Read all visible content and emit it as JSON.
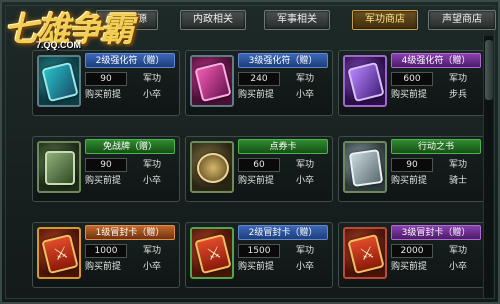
{
  "logo": {
    "title": "七雄争霸",
    "subtitle": "7.QQ.COM"
  },
  "tabs": [
    {
      "label": "购买资源"
    },
    {
      "label": "内政相关"
    },
    {
      "label": "军事相关"
    },
    {
      "label": "军功商店"
    },
    {
      "label": "声望商店"
    }
  ],
  "items": [
    {
      "name": "2级强化符（赠）",
      "price": "90",
      "currency": "军功",
      "requirement": "购买前提",
      "rank": "小卒"
    },
    {
      "name": "3级强化符（赠）",
      "price": "240",
      "currency": "军功",
      "requirement": "购买前提",
      "rank": "小卒"
    },
    {
      "name": "4级强化符（赠）",
      "price": "600",
      "currency": "军功",
      "requirement": "购买前提",
      "rank": "步兵"
    },
    {
      "name": "免战牌（赠）",
      "price": "90",
      "currency": "军功",
      "requirement": "购买前提",
      "rank": "小卒"
    },
    {
      "name": "点券卡",
      "price": "60",
      "currency": "军功",
      "requirement": "购买前提",
      "rank": "小卒"
    },
    {
      "name": "行动之书",
      "price": "90",
      "currency": "军功",
      "requirement": "购买前提",
      "rank": "骑士"
    },
    {
      "name": "1级冒封卡（赠）",
      "price": "1000",
      "currency": "军功",
      "requirement": "购买前提",
      "rank": "小卒"
    },
    {
      "name": "2级冒封卡（赠）",
      "price": "1500",
      "currency": "军功",
      "requirement": "购买前提",
      "rank": "小卒"
    },
    {
      "name": "3级冒封卡（赠）",
      "price": "2000",
      "currency": "军功",
      "requirement": "购买前提",
      "rank": "小卒"
    }
  ]
}
